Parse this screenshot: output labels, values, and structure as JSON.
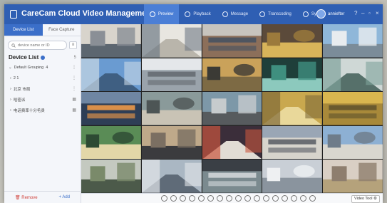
{
  "app": {
    "title": "CareCam Cloud Video Management"
  },
  "nav": [
    {
      "label": "Preview",
      "icon": "preview-icon"
    },
    {
      "label": "Playback",
      "icon": "playback-icon"
    },
    {
      "label": "Message",
      "icon": "message-icon"
    },
    {
      "label": "Transcoding",
      "icon": "transcoding-icon"
    },
    {
      "label": "System",
      "icon": "system-icon"
    }
  ],
  "user": {
    "name": "anniefter"
  },
  "window_controls": {
    "help": "?",
    "minimize": "–",
    "maximize": "▫",
    "close": "×"
  },
  "sidebar": {
    "tabs": [
      {
        "label": "Device List"
      },
      {
        "label": "Face Capture"
      }
    ],
    "search": {
      "placeholder": "device name or ID"
    },
    "list_title": "Device List",
    "list_count": "5",
    "tree": [
      {
        "label": "Default Grouping",
        "count": "4",
        "expand": "⌄"
      },
      {
        "label": "2 1",
        "expand": "›"
      },
      {
        "label": "北京 市局",
        "expand": "›"
      },
      {
        "label": "哈密派",
        "expand": "›"
      },
      {
        "label": "电话费率十分毛贵",
        "expand": "›"
      }
    ],
    "footer": {
      "remove": "Remove",
      "add": "Add"
    }
  },
  "bottom": {
    "video_tool": "Video Tool"
  },
  "colors": {
    "accent": "#2f5fb3",
    "active_nav": "#4b7fd6",
    "remove": "#d0413b"
  }
}
